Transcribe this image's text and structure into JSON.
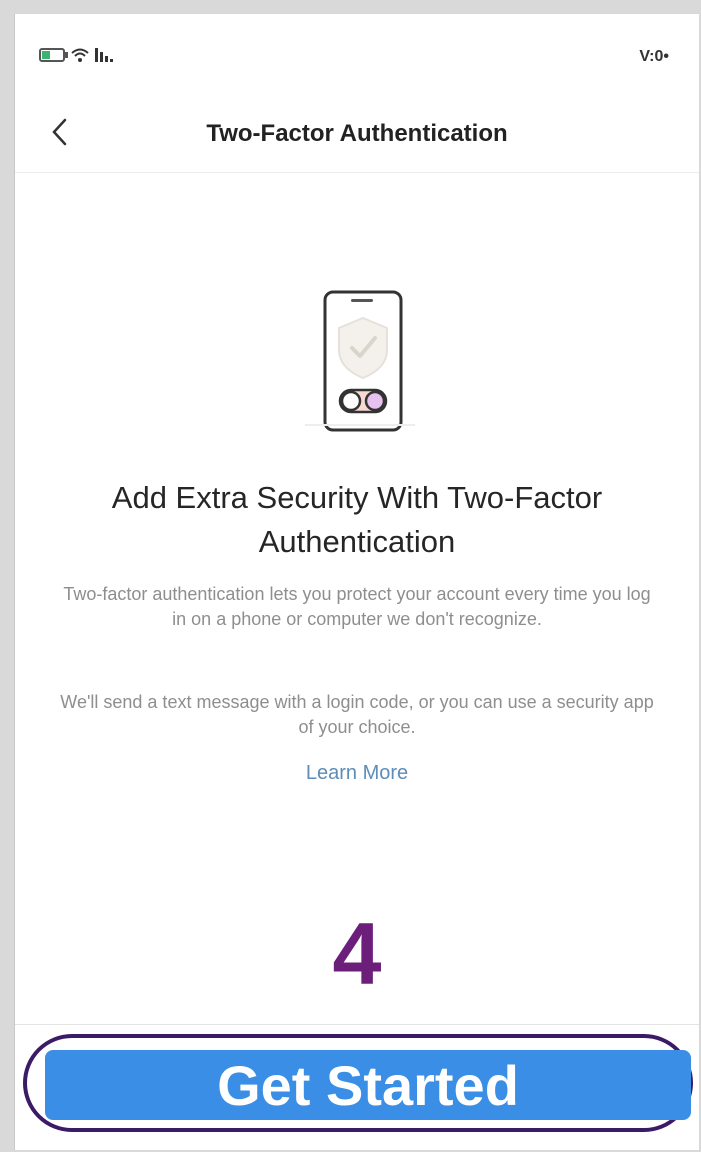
{
  "status_bar": {
    "time": "V:0•"
  },
  "nav": {
    "title": "Two-Factor Authentication"
  },
  "content": {
    "heading": "Add Extra Security With Two-Factor Authentication",
    "description_1": "Two-factor authentication lets you protect your account every time you log in on a phone or computer we don't recognize.",
    "description_2": "We'll send a text message with a login code, or you can use a security app of your choice.",
    "learn_more": "Learn More"
  },
  "annotation": {
    "step": "4"
  },
  "cta": {
    "label": "Get Started"
  },
  "colors": {
    "accent": "#3a8ee6",
    "link": "#5d8db8",
    "annotation": "#6b1f7a",
    "highlight_border": "#3b1a66"
  }
}
